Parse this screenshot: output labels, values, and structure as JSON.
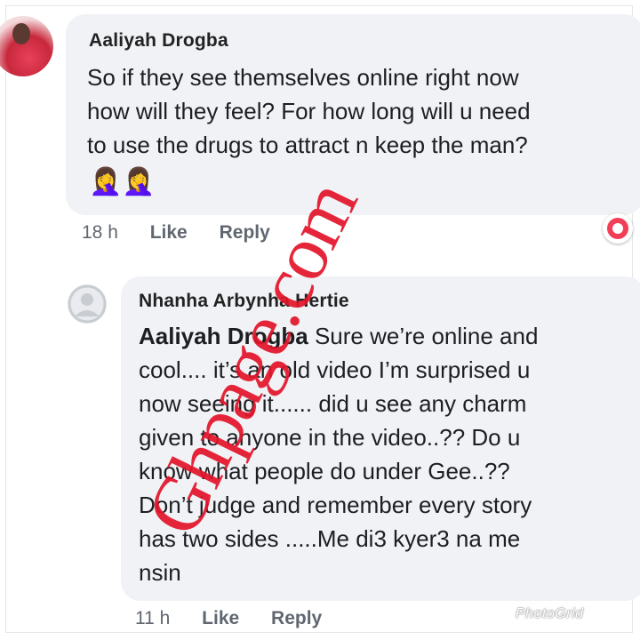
{
  "comment1": {
    "author": "Aaliyah Drogba",
    "lines": [
      "So if they see themselves online right now",
      "how will they feel? For how long will u need",
      "to use the drugs to attract n keep the man?"
    ],
    "emoji": "🤦‍♀️🤦‍♀️",
    "time": "18 h",
    "like": "Like",
    "reply": "Reply"
  },
  "comment2": {
    "author": "Nhanha Arbynha Hertie",
    "tag": "Aaliyah Drogba",
    "first_line_rest": " Sure we’re online and",
    "lines": [
      "cool.... it’s an old video I’m surprised u",
      "now seeing it...... did u see any charm",
      "given to anyone in the video..?? Do u",
      "know what people do under Gee..??",
      "Don’t judge and remember every story",
      "has two sides .....Me di3 kyer3 na me",
      "nsin"
    ],
    "time": "11 h",
    "like": "Like",
    "reply": "Reply"
  },
  "watermark": "Ghpage.com",
  "photogrid_label": "PhotoGrid",
  "colors": {
    "bubble": "#f0f2f5",
    "watermark": "#e3142a",
    "reaction": "#f33e58"
  }
}
